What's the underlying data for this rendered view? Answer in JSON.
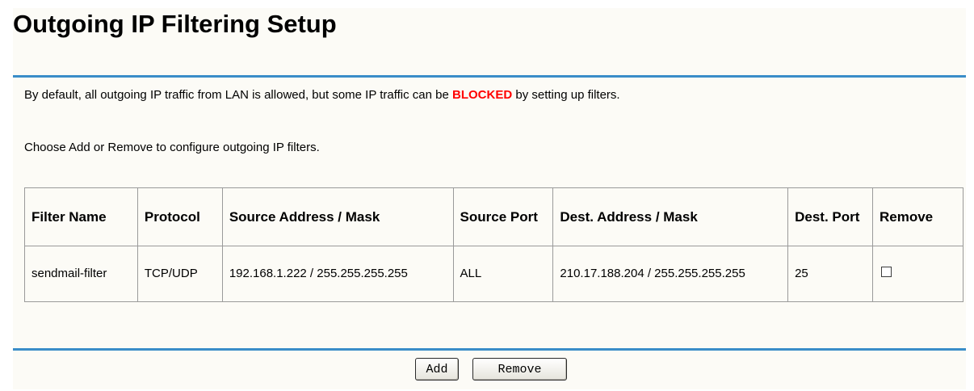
{
  "page": {
    "title": "Outgoing IP Filtering Setup",
    "intro_before": "By default, all outgoing IP traffic from LAN is allowed, but some IP traffic can be ",
    "intro_highlight": "BLOCKED",
    "intro_after": " by setting up filters.",
    "instruction": "Choose Add or Remove to configure outgoing IP filters."
  },
  "colors": {
    "accent_rule": "#3a8dc8",
    "highlight": "#ff0000",
    "panel_bg": "#fcfbf6"
  },
  "table": {
    "headers": {
      "filter_name": "Filter Name",
      "protocol": "Protocol",
      "source_address": "Source Address / Mask",
      "source_port": "Source Port",
      "dest_address": "Dest. Address / Mask",
      "dest_port": "Dest. Port",
      "remove": "Remove"
    },
    "rows": [
      {
        "filter_name": "sendmail-filter",
        "protocol": "TCP/UDP",
        "source_address": "192.168.1.222 / 255.255.255.255",
        "source_port": "ALL",
        "dest_address": "210.17.188.204 / 255.255.255.255",
        "dest_port": "25",
        "remove_checked": false
      }
    ]
  },
  "buttons": {
    "add": "Add",
    "remove": "Remove"
  }
}
